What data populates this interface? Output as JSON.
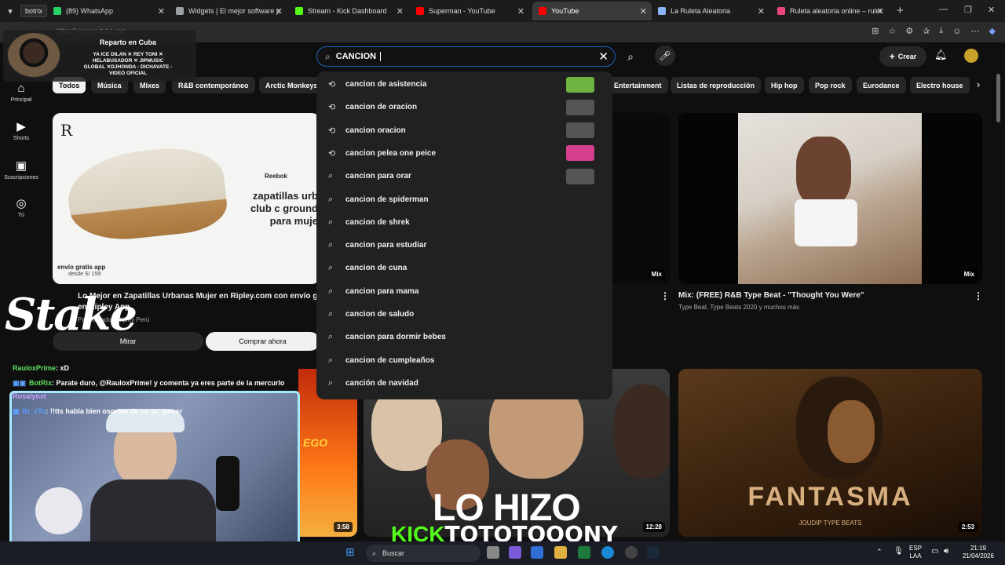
{
  "browser": {
    "profile_label": "botrix",
    "tabs": [
      {
        "title": "(89) WhatsApp",
        "color": "#25d366"
      },
      {
        "title": "Widgets | El mejor software para...",
        "color": "#9aa0a6"
      },
      {
        "title": "Stream - Kick Dashboard",
        "color": "#53fc18"
      },
      {
        "title": "Superman - YouTube",
        "color": "#ff0000"
      },
      {
        "title": "YouTube",
        "color": "#ff0000",
        "active": true
      },
      {
        "title": "La Ruleta Aleatoria",
        "color": "#8ab4f8"
      },
      {
        "title": "Ruleta aleatoria online – ruleta d",
        "color": "#e8457c"
      }
    ],
    "address": "https://www.youtube.com"
  },
  "youtube": {
    "search": {
      "value": "CANCION ",
      "placeholder": "Buscar"
    },
    "create_label": "Crear",
    "sidebar": [
      {
        "label": "Principal",
        "icon": "home-icon"
      },
      {
        "label": "Shorts",
        "icon": "shorts-icon"
      },
      {
        "label": "Suscripciones",
        "icon": "subscriptions-icon"
      },
      {
        "label": "Tú",
        "icon": "you-icon"
      }
    ],
    "chips": [
      "Todos",
      "Música",
      "Mixes",
      "R&B contemporáneo",
      "Arctic Monkeys",
      "Entertainment",
      "Listas de reproducción",
      "Hip hop",
      "Pop rock",
      "Eurodance",
      "Electro house"
    ],
    "suggestions": [
      {
        "text": "cancion de asistencia",
        "type": "history",
        "thumb": "#6db33f"
      },
      {
        "text": "cancion de oracion",
        "type": "history",
        "thumb": "#555555"
      },
      {
        "text": "cancion oracion",
        "type": "history",
        "thumb": "#555555"
      },
      {
        "text": "cancion pelea one peice",
        "type": "history",
        "thumb": "#d43f8d"
      },
      {
        "text": "cancion para orar",
        "type": "search",
        "thumb": "#555555"
      },
      {
        "text": "cancion de spiderman",
        "type": "search"
      },
      {
        "text": "cancion de shrek",
        "type": "search"
      },
      {
        "text": "cancion para estudiar",
        "type": "search"
      },
      {
        "text": "cancion de cuna",
        "type": "search"
      },
      {
        "text": "cancion para mama",
        "type": "search"
      },
      {
        "text": "cancion de saludo",
        "type": "search"
      },
      {
        "text": "cancion para dormir bebes",
        "type": "search"
      },
      {
        "text": "cancion de cumpleaños",
        "type": "search"
      },
      {
        "text": "canción de navidad",
        "type": "search"
      }
    ],
    "ad": {
      "brand": "Reebok",
      "headline": "zapatillas urb club c ground para muje",
      "ship": "envío gratis app",
      "ship_price": "desde S/ 159",
      "title": "Lo Mejor en Zapatillas Urbanas Mujer en Ripley.com con envío g en Ripley App",
      "sponsor": "Patrocinado · Ripley Perú",
      "btn_view": "Mirar",
      "btn_buy": "Comprar ahora"
    },
    "videos": [
      {
        "title": "Mix: (FREE) R&B Type Beat - \"Thought You Were\"",
        "channel": "Type Beat, Type Beats 2020 y muchos más",
        "badge": "Mix"
      },
      {
        "badge": "Mix"
      },
      {
        "badge": "3:58"
      },
      {
        "badge": "12:28",
        "overlay_text": "LO HIZO"
      },
      {
        "badge": "2:53",
        "overlay_text": "FANTASMA",
        "overlay_sub": "JOUDIP TYPE BEATS"
      }
    ]
  },
  "stream_overlay": {
    "box_title": "Reparto en Cuba",
    "box_lines": [
      "YA ICE DILAN ✕ REY TONI ✕",
      "HELABUSADOR ✕ JIPMUSIC",
      "GLOBAL ✕DJHONDA - DICHAVATE -",
      "VIDEO OFICIAL"
    ],
    "brand": "Stake",
    "chat": [
      {
        "user": "RauloxPrime",
        "msg": ": xD",
        "color": "#5fe05f"
      },
      {
        "user": "BotRix",
        "msg": ": Parate duro, @RauloxPrime! y comenta ya eres parte de la mercurlo",
        "color": "#5fe05f"
      },
      {
        "user": "Rosalynst",
        "msg": "",
        "color": "#c8a2ff"
      },
      {
        "user": "Itz_zTo",
        "msg": ": !!tts habla bien osorteo de un pc gamer",
        "color": "#5aa0ff"
      }
    ],
    "kick_label": "KICK",
    "kick_user": "TOTOTOOONY"
  },
  "taskbar": {
    "search_label": "Buscar",
    "lang_top": "ESP",
    "lang_bottom": "LAA",
    "time": "21:19",
    "date": "21/04/2026"
  }
}
